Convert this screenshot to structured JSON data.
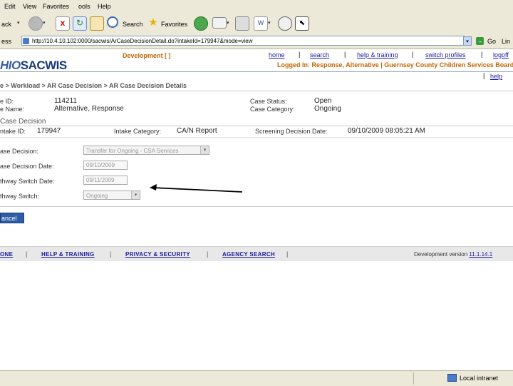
{
  "browser": {
    "menu": [
      "Edit",
      "View",
      "Favorites",
      "ools",
      "Help"
    ],
    "toolbar": {
      "back_label": "ack",
      "search_label": "Search",
      "favorites_label": "Favorites"
    },
    "address": {
      "label": "ess",
      "url": "http://10.4.10.102:0000/sacwis/ArCaseDecisionDetail.do?intakeId=179947&mode=view",
      "go_label": "Go",
      "links_label": "Lin"
    }
  },
  "app": {
    "logo": {
      "prefix": "HIO",
      "name": "SACWIS"
    },
    "environment": "Development [ ]",
    "nav": [
      "home",
      "search",
      "help & training",
      "switch profiles",
      "logoff"
    ],
    "logged_in_label": "Logged In:",
    "logged_in_value": "Response, Alternative | Guernsey County Children Services Board |",
    "help_link": "help",
    "breadcrumb": "e > Workload > AR Case Decision > AR Case Decision Details",
    "case": {
      "id_label": "e ID:",
      "id_value": "114211",
      "name_label": "e Name:",
      "name_value": "Alternative, Response",
      "status_label": "Case Status:",
      "status_value": "Open",
      "category_label": "Case Category:",
      "category_value": "Ongoing"
    },
    "section_title": "Case Decision",
    "intake": {
      "id_label": "ntake ID:",
      "id_value": "179947",
      "category_label": "Intake Category:",
      "category_value": "CA/N Report",
      "screening_label": "Screening Decision Date:",
      "screening_value": "09/10/2009 08:05:21 AM"
    },
    "form": {
      "decision_label": "ase Decision:",
      "decision_value": "Transfer for Ongoing - CSA Services",
      "decision_date_label": "ase Decision Date:",
      "decision_date_value": "09/10/2009",
      "switch_date_label": "thway Switch Date:",
      "switch_date_value": "09/11/2009",
      "switch_label": "thway Switch:",
      "switch_value": "Ongoing"
    },
    "cancel_label": "ancel",
    "footer": {
      "links": [
        "ONE",
        "HELP & TRAINING",
        "PRIVACY & SECURITY",
        "AGENCY SEARCH"
      ],
      "version_label": "Development version",
      "version_value": "11.1.14.1"
    }
  },
  "status": {
    "zone": "Local intranet"
  }
}
